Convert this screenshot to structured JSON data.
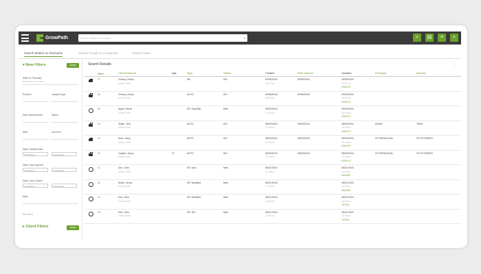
{
  "app": {
    "name": "GrowPath",
    "search_placeholder": "Search Matters & Clients"
  },
  "toolbar": {
    "icons": [
      "search-icon",
      "document-icon",
      "list-icon",
      "add-icon"
    ]
  },
  "tabs": [
    {
      "label": "Search Matters & Claimants",
      "active": true
    },
    {
      "label": "Search People & Companies",
      "active": false
    },
    {
      "label": "Search Notes",
      "active": false
    }
  ],
  "filters": {
    "new_filters_title": "New Filters",
    "apply_label": "Apply",
    "state_label": "State or Fiduciary",
    "state_value": "Both Open and Closed",
    "practice_label": "Practice",
    "lawsuit_label": "Lawsuit Type",
    "date_open_label": "Date Open/Closed",
    "status_label": "Status",
    "staff_label": "Staff",
    "jobfirm_label": "Job Firm",
    "dcd_label": "Date Created Date",
    "dco_label": "Date Case Opened",
    "dcc_label": "Date Case Closed",
    "date_placeholder": "mm/dd/yyyy",
    "note_label": "Note",
    "see_more": "See More",
    "client_filters_title": "Client Filters"
  },
  "results": {
    "title": "Search Results",
    "headers": [
      "Ctrl",
      "Client/Claimant",
      "Age",
      "Type",
      "Status",
      "Created",
      "Date Opened",
      "Updated",
      "Paralegal",
      "Attorney"
    ],
    "rows": [
      {
        "icon": "briefcase-icon",
        "id": "57",
        "client": "Cheezy, Dohry",
        "client_sub": "Intake Staff",
        "age": "",
        "type": "WC",
        "status": "INV",
        "created": "09/05/2018",
        "created_sub": "08:57am",
        "opened": "09/05/2018",
        "updated": "09/05/2018",
        "updated_sub": "08:57am",
        "updated_by": "ASHLEY",
        "paralegal": "",
        "attorney": ""
      },
      {
        "icon": "briefcase-icon",
        "id": "56",
        "client": "Cheezy, Dohry",
        "client_sub": "Intake Staff",
        "age": "",
        "type": "AUTO",
        "status": "INV",
        "created": "09/05/2018",
        "created_sub": "08:52am",
        "opened": "09/05/2018",
        "updated": "09/05/2018",
        "updated_sub": "08:52am",
        "updated_by": "ASHLEY",
        "paralegal": "",
        "attorney": ""
      },
      {
        "icon": "clock-icon",
        "id": "55",
        "client": "Apple, Randi",
        "client_sub": "Intake Staff",
        "age": "",
        "type": "WT: Dog Bite",
        "status": "New",
        "created": "08/30/2018",
        "created_sub": "10:54am",
        "opened": "",
        "updated": "09/05/2018",
        "updated_sub": "08:16am",
        "updated_by": "ASHLEY",
        "paralegal": "",
        "attorney": ""
      },
      {
        "icon": "briefcase-icon",
        "id": "54",
        "client": "Tester, Test",
        "client_sub": "Intake Staff",
        "age": "",
        "type": "AUTO",
        "status": "INV",
        "created": "08/29/2018",
        "created_sub": "03:45pm",
        "opened": "08/29/2018",
        "updated": "08/29/2018",
        "updated_sub": "03:45pm",
        "updated_by": "ASHLEY",
        "paralegal": "DAVAY",
        "attorney": "TARA"
      },
      {
        "icon": "briefcase-icon",
        "id": "53",
        "client": "Suck, Sazy",
        "client_sub": "Intake Staff",
        "age": "",
        "type": "AUTO",
        "status": "INV",
        "created": "08/29/2018",
        "created_sub": "01:42pm",
        "opened": "08/29/2018",
        "updated": "08/29/2018",
        "updated_sub": "01:42pm",
        "updated_by": "ASHLEY",
        "paralegal": "GF PARALEGAL",
        "attorney": "GF ATTORNEY"
      },
      {
        "icon": "briefcase-icon",
        "id": "52",
        "client": "Joseph, Jenny",
        "client_sub": "Intake Staff",
        "age": "27",
        "type": "AUTO",
        "status": "INV",
        "created": "08/29/2018",
        "created_sub": "10:28am",
        "opened": "08/29/2018",
        "updated": "08/29/2018",
        "updated_sub": "10:28am",
        "updated_by": "ASHLEY",
        "paralegal": "GF PARALEGAL",
        "attorney": "GF ATTORNEY"
      },
      {
        "icon": "clock-icon",
        "id": "51",
        "client": "Doe, John",
        "client_sub": "Intake Staff",
        "age": "",
        "type": "WT: Auto",
        "status": "New",
        "created": "08/21/2018",
        "created_sub": "11:06am",
        "opened": "",
        "updated": "08/21/2018",
        "updated_sub": "11:06am",
        "updated_by": "MANDIE",
        "paralegal": "",
        "attorney": ""
      },
      {
        "icon": "clock-icon",
        "id": "50",
        "client": "Smith, Jenny",
        "client_sub": "Intake Staff",
        "age": "",
        "type": "WT: Maritime",
        "status": "New",
        "created": "08/21/2018",
        "created_sub": "11:01am",
        "opened": "",
        "updated": "08/21/2018",
        "updated_sub": "11:01am",
        "updated_by": "MANDIE",
        "paralegal": "",
        "attorney": ""
      },
      {
        "icon": "clock-icon",
        "id": "49",
        "client": "Doe, John",
        "client_sub": "Intake Staff",
        "age": "",
        "type": "WT: Maritime",
        "status": "New",
        "created": "08/21/2018",
        "created_sub": "10:59am",
        "opened": "",
        "updated": "08/21/2018",
        "updated_sub": "10:59am",
        "updated_by": "TASHA",
        "paralegal": "",
        "attorney": ""
      },
      {
        "icon": "clock-icon",
        "id": "48",
        "client": "Doe, John",
        "client_sub": "Intake Staff",
        "age": "",
        "type": "WT: WC",
        "status": "New",
        "created": "08/21/2018",
        "created_sub": "10:58am",
        "opened": "",
        "updated": "08/21/2018",
        "updated_sub": "10:58am",
        "updated_by": "TASHA",
        "paralegal": "",
        "attorney": ""
      }
    ]
  }
}
